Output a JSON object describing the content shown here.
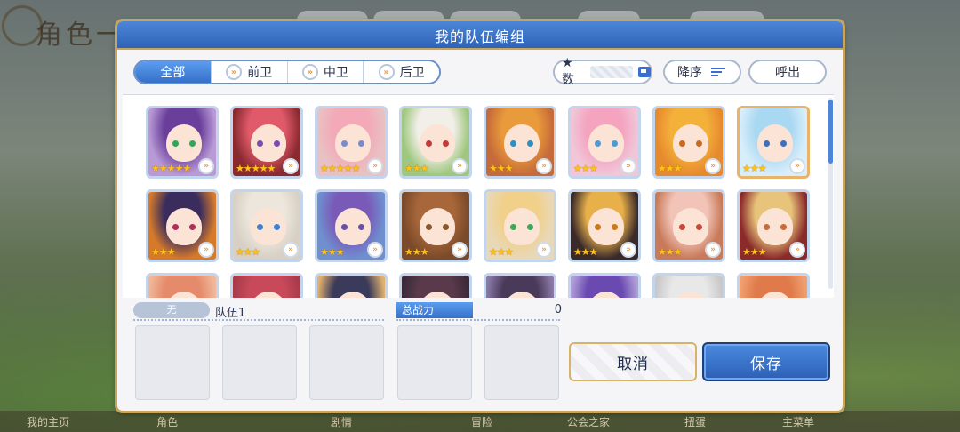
{
  "background": {
    "screen_title": "角色一览",
    "bottom_nav": [
      "我的主页",
      "角色",
      "剧情",
      "冒险",
      "公会之家",
      "扭蛋",
      "主菜单"
    ]
  },
  "dialog": {
    "title": "我的队伍编组",
    "tabs": [
      {
        "label": "全部",
        "icon": ""
      },
      {
        "label": "前卫",
        "icon": "chevron-icon"
      },
      {
        "label": "中卫",
        "icon": "chevron-icon"
      },
      {
        "label": "后卫",
        "icon": "chevron-icon"
      }
    ],
    "sort_star_label": "★数",
    "sort_order_label": "降序",
    "call_label": "呼出",
    "characters": [
      {
        "stars": 5,
        "hair": "#6a3f9b",
        "bg": "#b99ad6",
        "eye": "#2fa65a",
        "frame": "blue"
      },
      {
        "stars": 5,
        "hair": "#e05a6a",
        "bg": "#8a2a2f",
        "eye": "#7a4bb0",
        "frame": "blue"
      },
      {
        "stars": 5,
        "hair": "#f3a9b7",
        "bg": "#e8c1c4",
        "eye": "#7a8ad0",
        "frame": "blue"
      },
      {
        "stars": 3,
        "hair": "#f2eee8",
        "bg": "#9fc77f",
        "eye": "#c23b3b",
        "frame": "blue"
      },
      {
        "stars": 3,
        "hair": "#e99a3a",
        "bg": "#c56a3a",
        "eye": "#2f8fc4",
        "frame": "blue"
      },
      {
        "stars": 3,
        "hair": "#f4a4bf",
        "bg": "#f0c6d8",
        "eye": "#4f9ad6",
        "frame": "blue"
      },
      {
        "stars": 3,
        "hair": "#f3b13a",
        "bg": "#e68a2e",
        "eye": "#c86a1f",
        "frame": "blue"
      },
      {
        "stars": 3,
        "hair": "#a9d8f2",
        "bg": "#d8eefa",
        "eye": "#3f6fbf",
        "frame": "gold"
      },
      {
        "stars": 3,
        "hair": "#3a2d5e",
        "bg": "#d67a2a",
        "eye": "#b02f5a",
        "frame": "blue"
      },
      {
        "stars": 3,
        "hair": "#ece6dc",
        "bg": "#d8d0c4",
        "eye": "#3f7fd0",
        "frame": "blue"
      },
      {
        "stars": 3,
        "hair": "#7a5ab8",
        "bg": "#6f8fcf",
        "eye": "#6a4fa8",
        "frame": "blue"
      },
      {
        "stars": 3,
        "hair": "#a8673a",
        "bg": "#7a4a2a",
        "eye": "#8a5a2a",
        "frame": "blue"
      },
      {
        "stars": 3,
        "hair": "#f1d08a",
        "bg": "#e8d8b8",
        "eye": "#3fa65a",
        "frame": "blue"
      },
      {
        "stars": 3,
        "hair": "#e8b04a",
        "bg": "#3a2a2a",
        "eye": "#c87a1f",
        "frame": "blue"
      },
      {
        "stars": 3,
        "hair": "#f2c4b8",
        "bg": "#c87a5a",
        "eye": "#c84a3a",
        "frame": "blue"
      },
      {
        "stars": 3,
        "hair": "#e8c47a",
        "bg": "#8a2a2a",
        "eye": "#c86a3a",
        "frame": "blue"
      },
      {
        "stars": 0,
        "hair": "#e58a6a",
        "bg": "#f0b89a",
        "eye": "#888",
        "frame": "blue"
      },
      {
        "stars": 0,
        "hair": "#c84a5a",
        "bg": "#a83a4a",
        "eye": "#888",
        "frame": "blue"
      },
      {
        "stars": 0,
        "hair": "#3a3a5a",
        "bg": "#e0b070",
        "eye": "#888",
        "frame": "blue"
      },
      {
        "stars": 0,
        "hair": "#5a3a4a",
        "bg": "#3a2a3a",
        "eye": "#888",
        "frame": "blue"
      },
      {
        "stars": 0,
        "hair": "#4a3a5a",
        "bg": "#8a7aa8",
        "eye": "#888",
        "frame": "blue"
      },
      {
        "stars": 0,
        "hair": "#6a4ab0",
        "bg": "#b0a0d8",
        "eye": "#888",
        "frame": "blue"
      },
      {
        "stars": 0,
        "hair": "#e8e8e8",
        "bg": "#c8c8c8",
        "eye": "#888",
        "frame": "blue"
      },
      {
        "stars": 0,
        "hair": "#e07a4a",
        "bg": "#f0a070",
        "eye": "#888",
        "frame": "blue"
      }
    ],
    "team": {
      "type_label": "无",
      "name": "队伍1",
      "power_label": "总战力",
      "power_value": "0"
    },
    "cancel_label": "取消",
    "save_label": "保存"
  }
}
